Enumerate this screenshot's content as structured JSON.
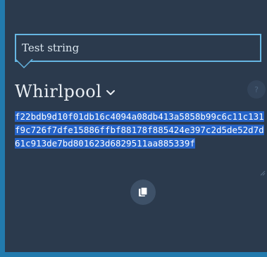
{
  "input": {
    "value": "Test string"
  },
  "algorithm": {
    "name": "Whirlpool"
  },
  "help": {
    "label": "?"
  },
  "output": {
    "hash": "f22bdb9d10f01db16c4094a08db413a5858b99c6c11c131f9c726f7dfe15886ffbf88178f885424e397c2d5de52d7d61c913de7bd801623d6829511aa885339f"
  },
  "icons": {
    "chevron": "chevron-down-icon",
    "copy": "clipboard-icon"
  },
  "colors": {
    "panel_bg": "#2b3a4d",
    "accent_border": "#227aad",
    "input_border": "#66b6e2",
    "selection": "#2563c8"
  }
}
